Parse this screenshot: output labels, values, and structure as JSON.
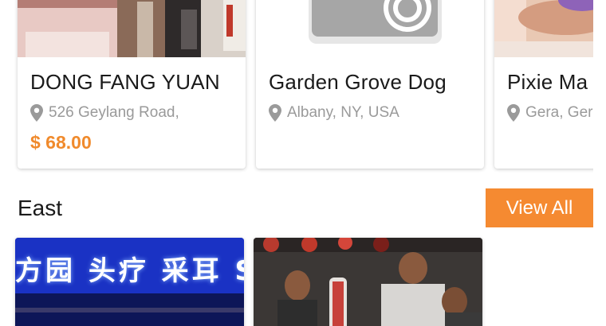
{
  "featured": [
    {
      "title": "DONG FANG YUAN",
      "location": "526 Geylang Road,",
      "price": "$ 68.00",
      "image": "salon-interior-photo"
    },
    {
      "title": "Garden Grove Dog",
      "location": "Albany, NY, USA",
      "image": "camera-placeholder"
    },
    {
      "title": "Pixie Ma",
      "location": "Gera, Gern",
      "image": "massage-photo"
    }
  ],
  "section": {
    "title": "East",
    "view_all_label": "View All"
  },
  "east_items": [
    {
      "image": "shop-signboard-photo",
      "sign_text": "方园 头疗 采耳 S"
    },
    {
      "image": "barbershop-photo"
    }
  ],
  "icons": {
    "location": "map-pin-icon",
    "placeholder": "camera-icon"
  },
  "colors": {
    "accent": "#f58a31",
    "price": "#f08a2c",
    "secondary_text": "#9a9a9a"
  }
}
